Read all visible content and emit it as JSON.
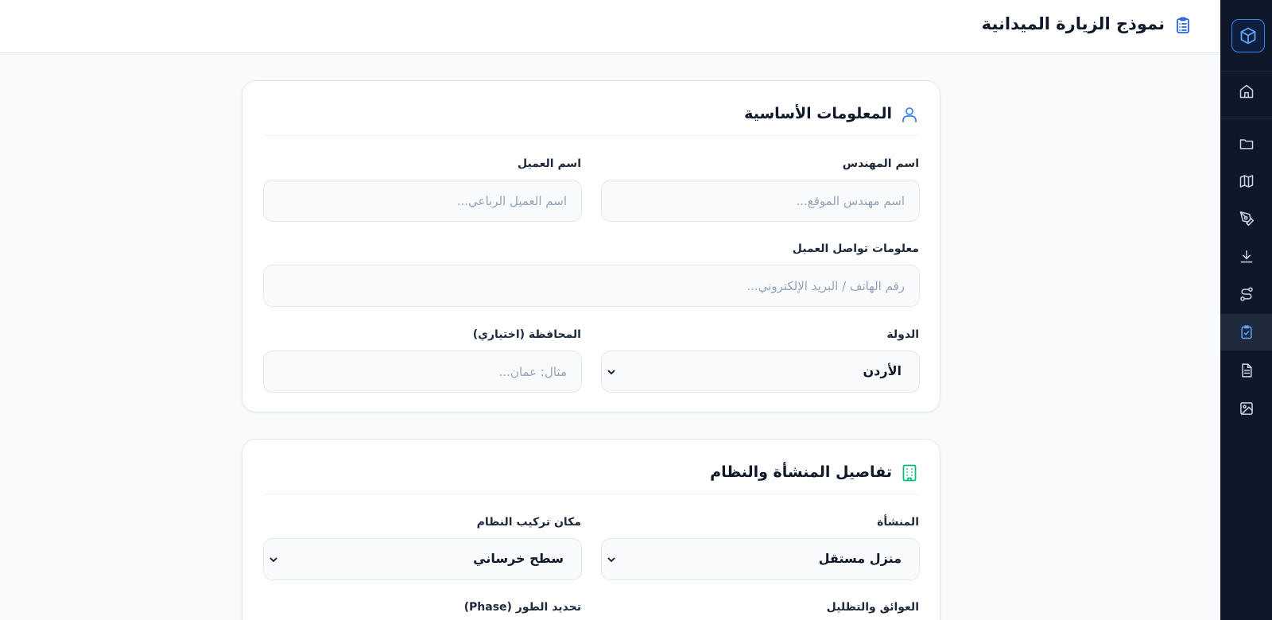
{
  "header": {
    "title": "نموذج الزيارة الميدانية",
    "icon": "clipboard-list-icon"
  },
  "sidebar": {
    "logo_icon": "cube-icon",
    "items": [
      {
        "icon": "home-icon",
        "active": false
      },
      {
        "icon": "folder-icon",
        "active": false
      },
      {
        "icon": "map-icon",
        "active": false
      },
      {
        "icon": "pen-tool-icon",
        "active": false
      },
      {
        "icon": "download-icon",
        "active": false
      },
      {
        "icon": "route-icon",
        "active": false
      },
      {
        "icon": "clipboard-check-icon",
        "active": true
      },
      {
        "icon": "file-text-icon",
        "active": false
      },
      {
        "icon": "image-icon",
        "active": false
      }
    ]
  },
  "basic_info": {
    "title": "المعلومات الأساسية",
    "icon": "user-icon",
    "engineer_label": "اسم المهندس",
    "engineer_placeholder": "اسم مهندس الموقع...",
    "client_label": "اسم العميل",
    "client_placeholder": "اسم العميل الرباعي...",
    "contact_label": "معلومات تواصل العميل",
    "contact_placeholder": "رقم الهاتف / البريد الإلكتروني...",
    "country_label": "الدولة",
    "country_value": "الأردن",
    "governorate_label": "المحافظة (اختياري)",
    "governorate_placeholder": "مثال: عمان..."
  },
  "facility": {
    "title": "تفاصيل المنشأة والنظام",
    "icon": "building-icon",
    "facility_label": "المنشأة",
    "facility_value": "منزل مستقل",
    "install_label": "مكان تركيب النظام",
    "install_value": "سطح خرساني",
    "obstacles_label": "العوائق والتظليل",
    "phase_label": "تحديد الطور (Phase)"
  },
  "colors": {
    "accent": "#2563eb",
    "sidebar_bg": "#0f172a",
    "building_icon": "#10b981"
  }
}
